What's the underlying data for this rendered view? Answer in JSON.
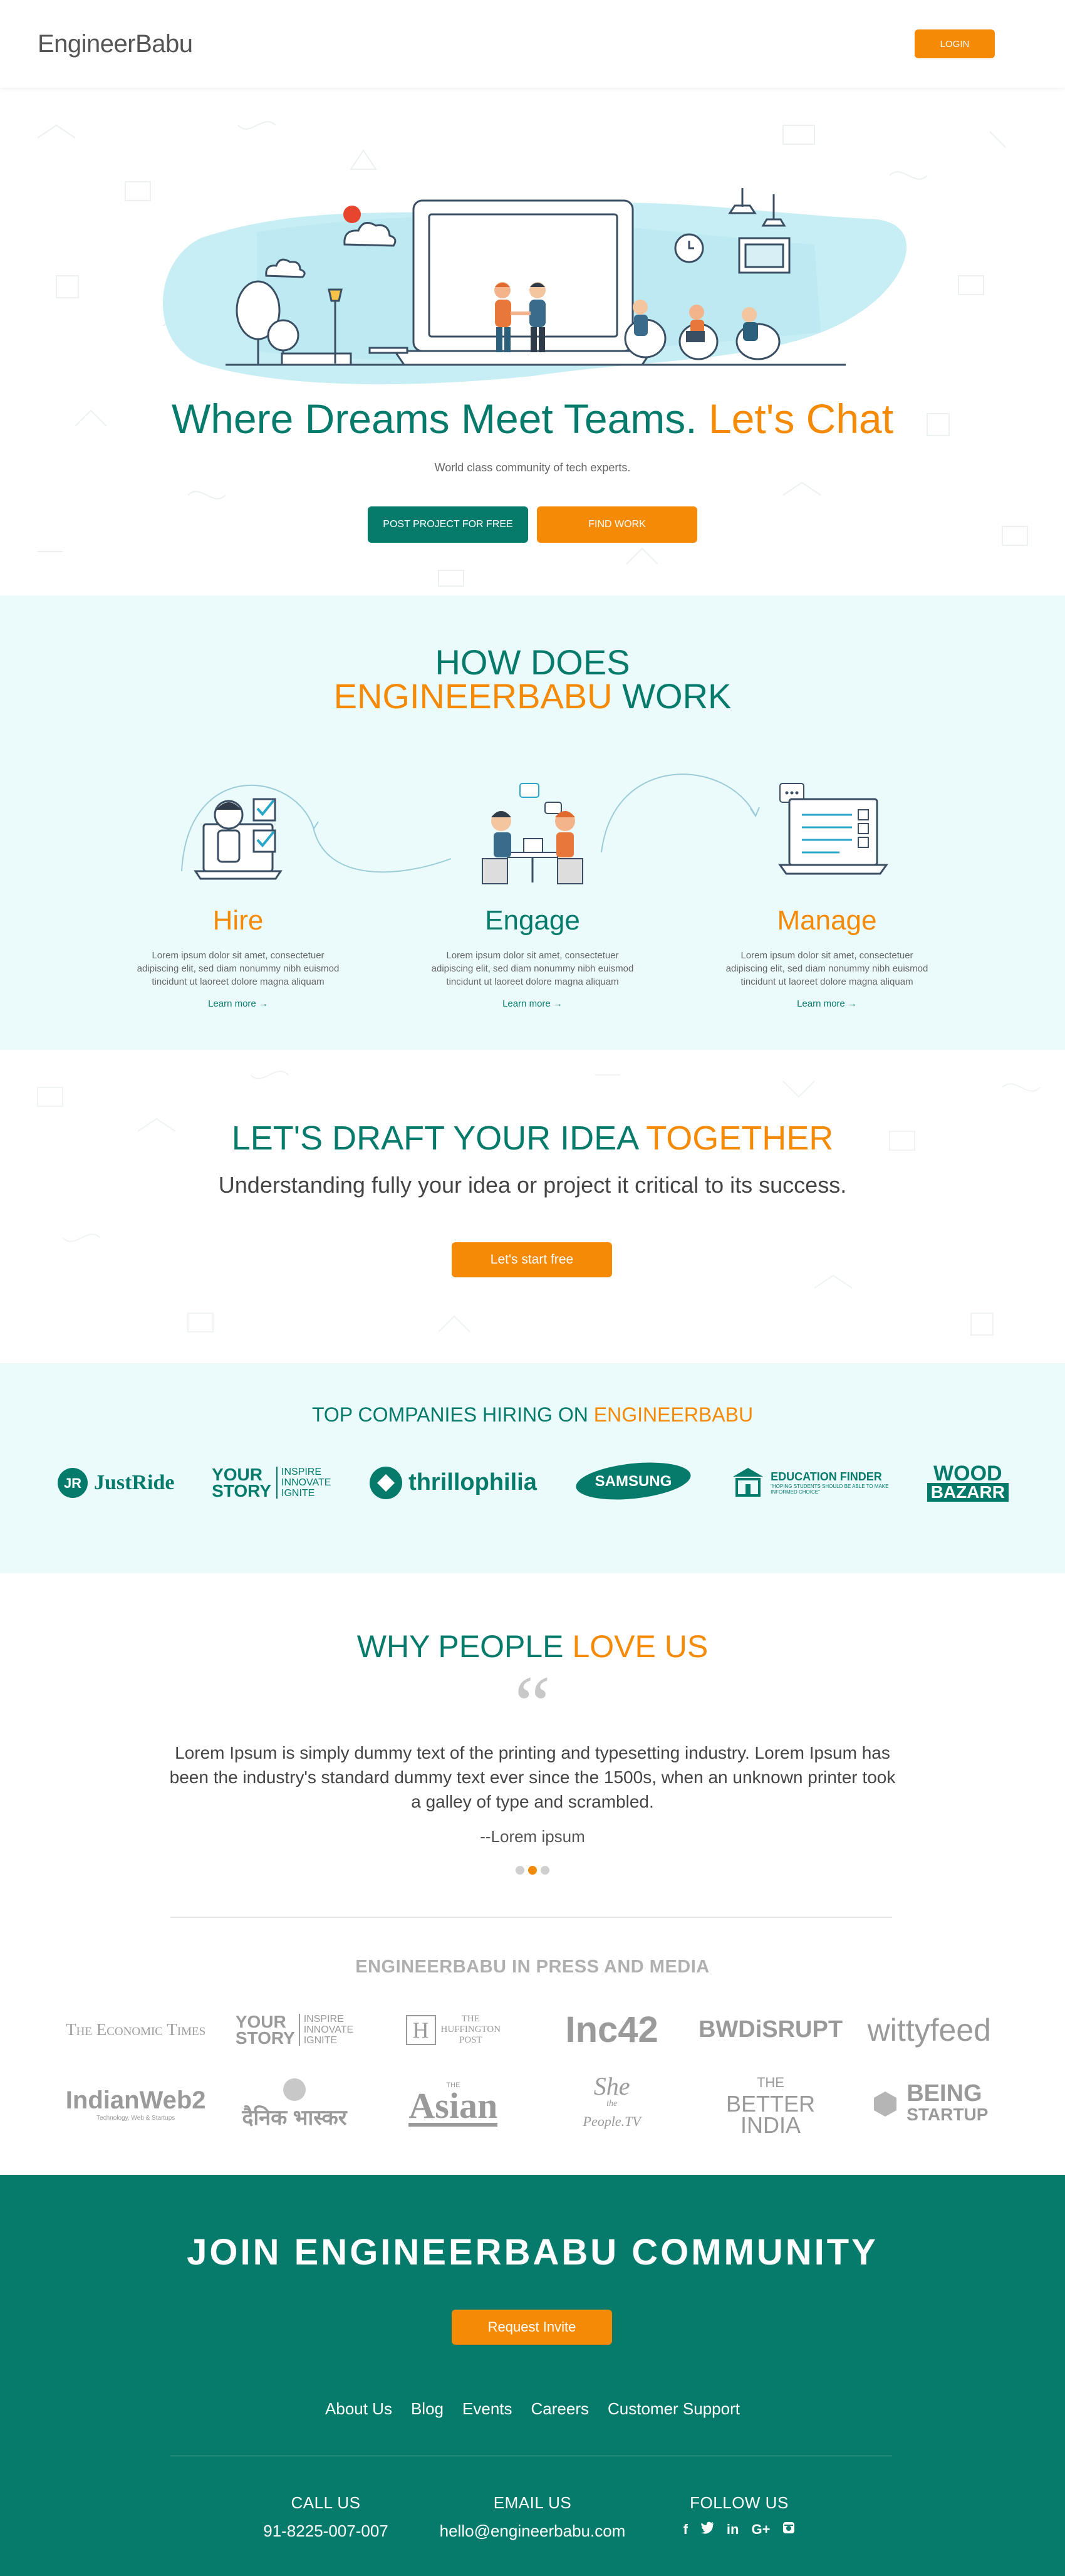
{
  "header": {
    "logo_first": "Engineer",
    "logo_second": "Babu",
    "login_label": "LOGIN"
  },
  "hero": {
    "title_main": "Where Dreams Meet Teams.",
    "title_accent": "Let's Chat",
    "subtitle": "World class community of tech experts.",
    "post_project_label": "POST PROJECT FOR FREE",
    "find_work_label": "FIND WORK"
  },
  "how": {
    "title_line1": "HOW DOES",
    "title_brand": "ENGINEERBABU",
    "title_work": "WORK",
    "steps": [
      {
        "name": "Hire",
        "desc": "Lorem ipsum dolor sit amet, consectetuer adipiscing elit, sed diam nonummy nibh euismod tincidunt ut laoreet dolore magna aliquam",
        "link": "Learn more →"
      },
      {
        "name": "Engage",
        "desc": "Lorem ipsum dolor sit amet, consectetuer adipiscing elit, sed diam nonummy nibh euismod tincidunt ut laoreet dolore magna aliquam",
        "link": "Learn more →"
      },
      {
        "name": "Manage",
        "desc": "Lorem ipsum dolor sit amet, consectetuer adipiscing elit, sed diam nonummy nibh euismod tincidunt ut laoreet dolore magna aliquam",
        "link": "Learn more →"
      }
    ]
  },
  "draft": {
    "title_main": "LET'S DRAFT YOUR IDEA",
    "title_accent": "TOGETHER",
    "subtitle": "Understanding fully your idea or project it critical to its success.",
    "cta_label": "Let's start free"
  },
  "companies": {
    "title_main": "TOP COMPANIES HIRING ON",
    "title_accent": "ENGINEERBABU",
    "logos": {
      "justride": "JustRide",
      "yourstory_a": "YOUR",
      "yourstory_b": "STORY",
      "yourstory_c": "INSPIRE",
      "yourstory_d": "INNOVATE",
      "yourstory_e": "IGNITE",
      "thrillophilia": "thrillophilia",
      "samsung": "SAMSUNG",
      "edufinder": "EDUCATION FINDER",
      "edufinder_sub": "\"HOPING STUDENTS SHOULD BE ABLE TO MAKE INFORMED CHOICE\"",
      "wood": "WOOD",
      "bazarr": "BAZARR"
    }
  },
  "love": {
    "title_main": "WHY PEOPLE",
    "title_accent": "LOVE US",
    "quote_mark": "“",
    "testimonial": "Lorem Ipsum is simply dummy text of the printing and typesetting industry. Lorem Ipsum has been the industry's standard dummy text ever since the 1500s, when an unknown printer took a galley of type and scrambled.",
    "author": "--Lorem ipsum",
    "press_title": "ENGINEERBABU IN PRESS AND MEDIA",
    "press": {
      "economic_times": "The Economic Times",
      "yourstory_a": "YOUR",
      "yourstory_b": "STORY",
      "yourstory_c": "INSPIRE",
      "yourstory_d": "INNOVATE",
      "yourstory_e": "IGNITE",
      "huffington_h": "H",
      "huffington_a": "THE",
      "huffington_b": "HUFFINGTON",
      "huffington_c": "POST",
      "inc42": "Inc42",
      "bwdisrupt": "BWDiSRUPT",
      "wittyfeed": "wittyfeed",
      "indianweb2": "IndianWeb2",
      "indianweb2_sub": "Technology, Web & Startups",
      "dainik": "दैनिक भास्कर",
      "asian_small": "THE",
      "asian": "Asian",
      "sheplace_a": "She",
      "sheplace_b": "the",
      "sheplace_c": "People.TV",
      "betterindia_a": "THE",
      "betterindia_b": "BETTER",
      "betterindia_c": "INDIA",
      "being_a": "BEING",
      "being_b": "STARTUP"
    }
  },
  "footer": {
    "join_title": "JOIN ENGINEERBABU COMMUNITY",
    "invite_label": "Request Invite",
    "nav": [
      "About Us",
      "Blog",
      "Events",
      "Careers",
      "Customer Support"
    ],
    "call_label": "CALL US",
    "call_value": "91-8225-007-007",
    "email_label": "EMAIL US",
    "email_value": "hello@engineerbabu.com",
    "follow_label": "FOLLOW US",
    "socials": [
      "f",
      "t",
      "in",
      "G+",
      "ig"
    ]
  },
  "colors": {
    "teal": "#067b6c",
    "orange": "#f58a07",
    "light_cyan": "#ebfbfb"
  }
}
